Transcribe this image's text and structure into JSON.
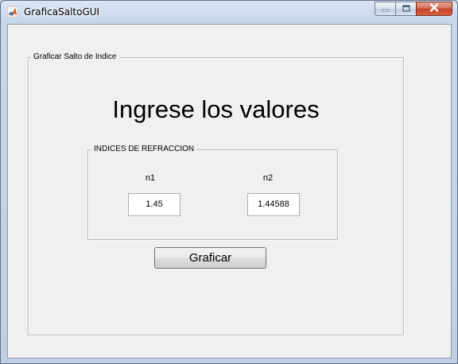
{
  "window": {
    "title": "GraficaSaltoGUI",
    "icon": "matlab-icon"
  },
  "caption_buttons": {
    "minimize_icon": "minimize-icon",
    "maximize_icon": "maximize-icon",
    "close_icon": "close-icon"
  },
  "outer_panel": {
    "title": "Graficar Salto de Indice"
  },
  "heading": "Ingrese los valores",
  "refraction_panel": {
    "title": "INDICES DE REFRACCION",
    "n1_label": "n1",
    "n1_value": "1.45",
    "n2_label": "n2",
    "n2_value": "1.44588"
  },
  "plot_button": {
    "label": "Graficar"
  },
  "colors": {
    "client_bg": "#f0f0f0",
    "close_button": "#c7432a",
    "frame": "#c7d6ea"
  }
}
